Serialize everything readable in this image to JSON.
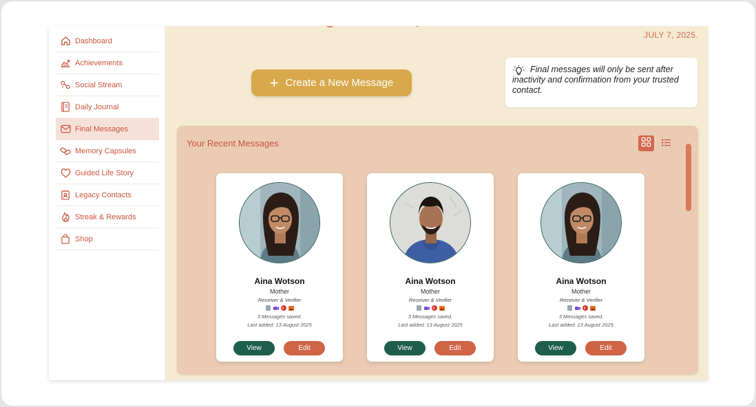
{
  "date": "JULY 7, 2025.",
  "sidebar": {
    "items": [
      {
        "label": "Dashboard",
        "icon": "home-icon"
      },
      {
        "label": "Achievements",
        "icon": "chart-line-icon"
      },
      {
        "label": "Social Stream",
        "icon": "social-stream-icon"
      },
      {
        "label": "Daily Journal",
        "icon": "journal-icon"
      },
      {
        "label": "Final Messages",
        "icon": "mail-icon",
        "active": true
      },
      {
        "label": "Memory Capsules",
        "icon": "capsule-icon"
      },
      {
        "label": "Guided Life Story",
        "icon": "heart-icon"
      },
      {
        "label": "Legacy Contacts",
        "icon": "contact-badge-icon"
      },
      {
        "label": "Streak & Rewards",
        "icon": "flame-icon"
      },
      {
        "label": "Shop",
        "icon": "shopping-bag-icon"
      }
    ]
  },
  "create_button": {
    "label": "Create a New Message"
  },
  "info": {
    "text": "Final messages will only be sent after inactivity and confirmation from your trusted contact."
  },
  "recent": {
    "title": "Your Recent Messages",
    "cards": [
      {
        "name": "Aina Wotson",
        "relation": "Mother",
        "role": "Receiver & Verifier",
        "saved": "3 Messages saved.",
        "last_added": "Last added: 13 August 2025",
        "view": "View",
        "edit": "Edit"
      },
      {
        "name": "Aina Wotson",
        "relation": "Mother",
        "role": "Receiver & Verifier",
        "saved": "3 Messages saved.",
        "last_added": "Last added: 13 August 2025",
        "view": "View",
        "edit": "Edit"
      },
      {
        "name": "Aina Wotson",
        "relation": "Mother",
        "role": "Receiver & Verifier",
        "saved": "3 Messages saved.",
        "last_added": "Last added: 13 August 2025",
        "view": "View",
        "edit": "Edit"
      }
    ]
  },
  "colors": {
    "accent": "#c8553d",
    "gold": "#d8a94b",
    "green": "#1f5e4d",
    "background": "#f5ebd3",
    "panel": "#ebcbb3"
  }
}
